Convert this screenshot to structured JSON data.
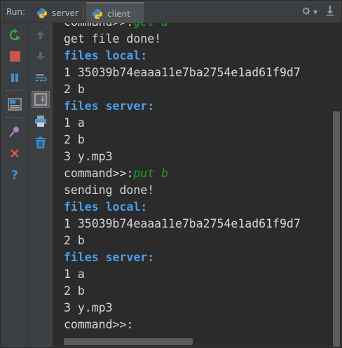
{
  "run_label": "Run:",
  "tabs": [
    {
      "label": "server",
      "icon": "python-icon",
      "selected": false
    },
    {
      "label": "client",
      "icon": "python-icon",
      "selected": true
    }
  ],
  "header_icons": [
    "gear-icon",
    "pin-icon"
  ],
  "left_toolbar": [
    "rerun-icon",
    "stop-icon",
    "pause-icon",
    "layout-icon",
    "pin-tab-icon",
    "close-icon",
    "help-icon"
  ],
  "mid_toolbar": [
    "up-arrow-icon",
    "down-arrow-icon",
    "soft-wrap-icon",
    "scroll-to-end-icon",
    "print-icon",
    "trash-icon"
  ],
  "console": {
    "lines": [
      {
        "parts": [
          {
            "t": "command>>:",
            "c": "out"
          },
          {
            "t": "get a",
            "c": "inp"
          }
        ]
      },
      {
        "parts": [
          {
            "t": "get file done!",
            "c": "out"
          }
        ]
      },
      {
        "parts": [
          {
            "t": "files local:",
            "c": "hdr"
          }
        ]
      },
      {
        "parts": [
          {
            "t": "1 35039b74eaaa11e7ba2754e1ad61f9d7",
            "c": "out"
          }
        ]
      },
      {
        "parts": [
          {
            "t": "2 b",
            "c": "out"
          }
        ]
      },
      {
        "parts": [
          {
            "t": "files server:",
            "c": "hdr"
          }
        ]
      },
      {
        "parts": [
          {
            "t": "1 a",
            "c": "out"
          }
        ]
      },
      {
        "parts": [
          {
            "t": "2 b",
            "c": "out"
          }
        ]
      },
      {
        "parts": [
          {
            "t": "3 y.mp3",
            "c": "out"
          }
        ]
      },
      {
        "parts": [
          {
            "t": "command>>:",
            "c": "out"
          },
          {
            "t": "put b",
            "c": "inp"
          }
        ]
      },
      {
        "parts": [
          {
            "t": "sending done!",
            "c": "out"
          }
        ]
      },
      {
        "parts": [
          {
            "t": "files local:",
            "c": "hdr"
          }
        ]
      },
      {
        "parts": [
          {
            "t": "1 35039b74eaaa11e7ba2754e1ad61f9d7",
            "c": "out"
          }
        ]
      },
      {
        "parts": [
          {
            "t": "2 b",
            "c": "out"
          }
        ]
      },
      {
        "parts": [
          {
            "t": "files server:",
            "c": "hdr"
          }
        ]
      },
      {
        "parts": [
          {
            "t": "1 a",
            "c": "out"
          }
        ]
      },
      {
        "parts": [
          {
            "t": "2 b",
            "c": "out"
          }
        ]
      },
      {
        "parts": [
          {
            "t": "3 y.mp3",
            "c": "out"
          }
        ]
      },
      {
        "parts": [
          {
            "t": "command>>:",
            "c": "out"
          }
        ]
      }
    ]
  },
  "colors": {
    "output": "#d8d8d8",
    "header": "#4a9eea",
    "user_input": "#1ca01c",
    "console_bg": "#2b2b2b",
    "panel_bg": "#3c3f41"
  }
}
